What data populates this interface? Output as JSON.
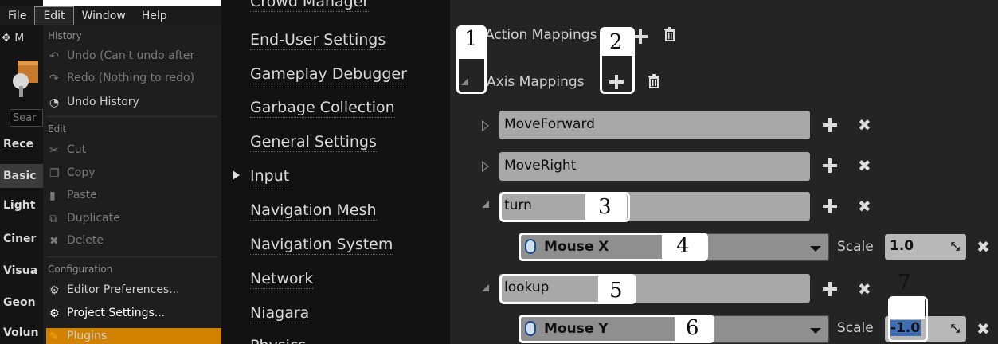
{
  "menubar": {
    "items": [
      "File",
      "Edit",
      "Window",
      "Help"
    ],
    "active": "Edit"
  },
  "left_panel": {
    "app_title_fragment": "M",
    "search_placeholder": "Sear",
    "items": [
      "Rece",
      "Basic",
      "Light",
      "Ciner",
      "Visua",
      "Geon",
      "Volun"
    ]
  },
  "edit_menu": {
    "history_section": "History",
    "undo_label": "Undo (Can't undo after",
    "redo_label": "Redo (Nothing to redo)",
    "undo_history_label": "Undo History",
    "edit_section": "Edit",
    "cut_label": "Cut",
    "copy_label": "Copy",
    "paste_label": "Paste",
    "duplicate_label": "Duplicate",
    "delete_label": "Delete",
    "config_section": "Configuration",
    "editor_prefs_label": "Editor Preferences...",
    "project_settings_label": "Project Settings...",
    "plugins_label": "Plugins",
    "highlight_color": "#d18100"
  },
  "categories": {
    "items": [
      "Crowd Manager",
      "End-User Settings",
      "Gameplay Debugger",
      "Garbage Collection",
      "General Settings",
      "Input",
      "Navigation Mesh",
      "Navigation System",
      "Network",
      "Niagara",
      "Physics"
    ]
  },
  "details": {
    "action_mappings_label": "Action Mappings",
    "axis_mappings_label": "Axis Mappings",
    "mappings": [
      {
        "name": "MoveForward"
      },
      {
        "name": "MoveRight"
      },
      {
        "name": "turn",
        "key": "Mouse X",
        "scale_label": "Scale",
        "scale": "1.0"
      },
      {
        "name": "lookup",
        "key": "Mouse Y",
        "scale_label": "Scale",
        "scale": "-1.0"
      }
    ]
  },
  "annotations": [
    "1",
    "2",
    "3",
    "4",
    "5",
    "6",
    "7"
  ]
}
